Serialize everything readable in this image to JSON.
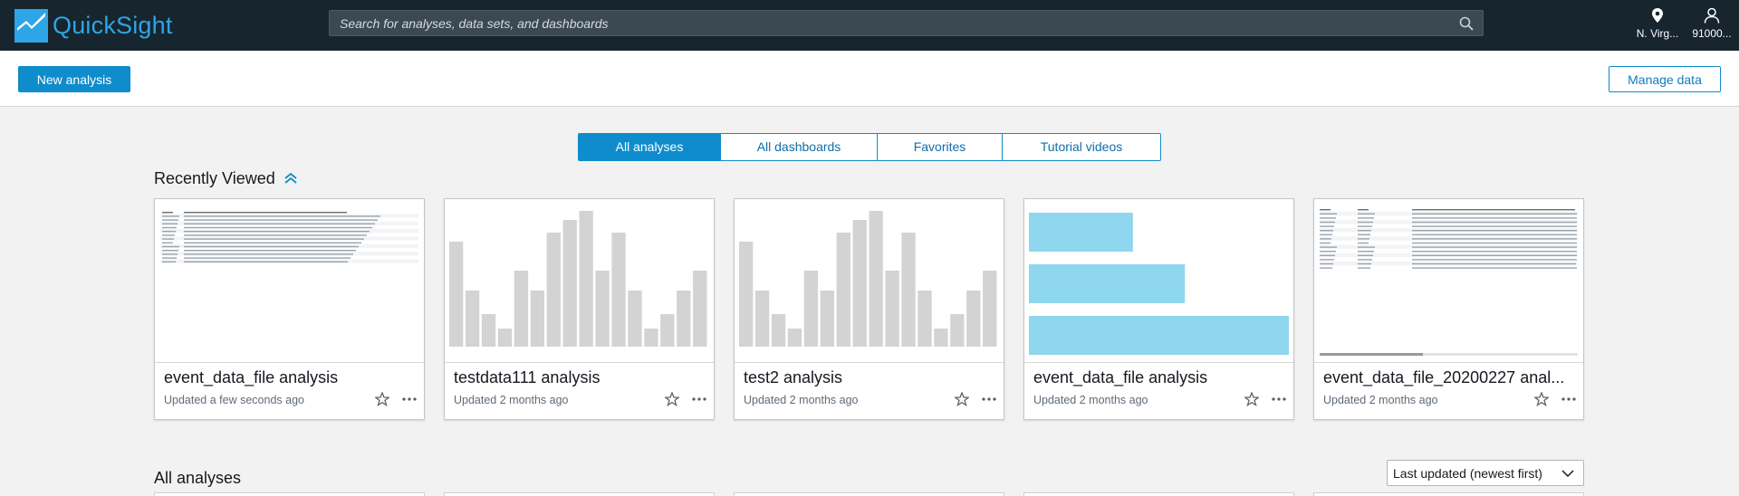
{
  "app": {
    "name": "QuickSight"
  },
  "search": {
    "placeholder": "Search for analyses, data sets, and dashboards"
  },
  "header": {
    "region_label": "N. Virg...",
    "account_label": "91000..."
  },
  "actions": {
    "new_analysis": "New analysis",
    "manage_data": "Manage data"
  },
  "tabs": [
    {
      "label": "All analyses",
      "active": true
    },
    {
      "label": "All dashboards",
      "active": false
    },
    {
      "label": "Favorites",
      "active": false
    },
    {
      "label": "Tutorial videos",
      "active": false
    }
  ],
  "recently_viewed": {
    "title": "Recently Viewed",
    "cards": [
      {
        "title": "event_data_file analysis",
        "updated": "Updated a few seconds ago",
        "thumbnail": "table"
      },
      {
        "title": "testdata111 analysis",
        "updated": "Updated 2 months ago",
        "thumbnail": "bar-chart"
      },
      {
        "title": "test2 analysis",
        "updated": "Updated 2 months ago",
        "thumbnail": "bar-chart"
      },
      {
        "title": "event_data_file analysis",
        "updated": "Updated 2 months ago",
        "thumbnail": "horizontal-bar-chart"
      },
      {
        "title": "event_data_file_20200227 anal...",
        "updated": "Updated 2 months ago",
        "thumbnail": "table"
      }
    ]
  },
  "all_analyses": {
    "title": "All analyses",
    "sort_label": "Last updated (newest first)"
  },
  "colors": {
    "topbar": "#16252e",
    "accent": "#0e8ccc",
    "thumb_bar_gray": "#d3d3d3",
    "thumb_bar_blue": "#8fd6ef"
  },
  "thumbnails": {
    "vertical_bars": [
      0.58,
      0.31,
      0.18,
      0.1,
      0.42,
      0.31,
      0.63,
      0.7,
      0.75,
      0.42,
      0.63,
      0.31,
      0.1,
      0.18,
      0.31,
      0.42
    ],
    "horizontal_bars": [
      0.4,
      0.6,
      1.0
    ]
  }
}
